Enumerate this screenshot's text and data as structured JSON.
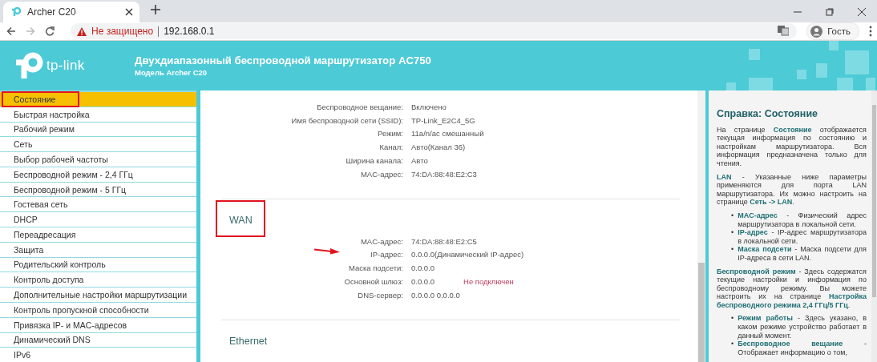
{
  "browser": {
    "tabs": [
      {
        "title": "Archer C20",
        "selected": true
      }
    ],
    "security": "Не защищено",
    "url": "192.168.0.1",
    "forward_disabled": true,
    "profile": "Гость"
  },
  "header": {
    "logo": "tp-link",
    "title": "Двухдиапазонный беспроводной маршрутизатор AC750",
    "model": "Модель Archer C20"
  },
  "menu": [
    {
      "label": "Состояние",
      "selected": true,
      "highlighted": true
    },
    {
      "label": "Быстрая настройка",
      "selected": false,
      "highlighted": false
    },
    {
      "label": "Рабочий режим",
      "selected": false,
      "highlighted": false
    },
    {
      "label": "Сеть",
      "selected": false,
      "highlighted": false
    },
    {
      "label": "Выбор рабочей частоты",
      "selected": false,
      "highlighted": false
    },
    {
      "label": "Беспроводной режим - 2,4 ГГц",
      "selected": false,
      "highlighted": false
    },
    {
      "label": "Беспроводной режим - 5 ГГц",
      "selected": false,
      "highlighted": false
    },
    {
      "label": "Гостевая сеть",
      "selected": false,
      "highlighted": false
    },
    {
      "label": "DHCP",
      "selected": false,
      "highlighted": false
    },
    {
      "label": "Переадресация",
      "selected": false,
      "highlighted": false
    },
    {
      "label": "Защита",
      "selected": false,
      "highlighted": false
    },
    {
      "label": "Родительский контроль",
      "selected": false,
      "highlighted": false
    },
    {
      "label": "Контроль доступа",
      "selected": false,
      "highlighted": false
    },
    {
      "label": "Дополнительные настройки маршрутизации",
      "selected": false,
      "highlighted": false
    },
    {
      "label": "Контроль пропускной способности",
      "selected": false,
      "highlighted": false
    },
    {
      "label": "Привязка IP- и MAC-адресов",
      "selected": false,
      "highlighted": false
    },
    {
      "label": "Динамический DNS",
      "selected": false,
      "highlighted": false
    },
    {
      "label": "IPv6",
      "selected": false,
      "highlighted": false
    }
  ],
  "sections": [
    {
      "rows": [
        {
          "label": "Беспроводное вещание:",
          "value": "Включено",
          "arrow": false
        },
        {
          "label": "Имя беспроводной сети (SSID):",
          "value": "TP-Link_E2C4_5G",
          "arrow": false
        },
        {
          "label": "Режим:",
          "value": "11a/n/ac смешанный",
          "arrow": false
        },
        {
          "label": "Канал:",
          "value": "Авто(Канал 36)",
          "arrow": false
        },
        {
          "label": "Ширина канала:",
          "value": "Авто",
          "arrow": false
        },
        {
          "label": "MAC-адрес:",
          "value": "74:DA:88:48:E2:C3",
          "arrow": false
        }
      ]
    },
    {
      "title": "WAN",
      "highlighted": true,
      "rows": [
        {
          "label": "MAC-адрес:",
          "value": "74:DA:88:48:E2:C5",
          "arrow": false
        },
        {
          "label": "IP-адрес:",
          "value": "0.0.0.0(Динамический IP-адрес)",
          "arrow": true
        },
        {
          "label": "Маска подсети:",
          "value": "0.0.0.0",
          "arrow": false
        },
        {
          "label": "Основной шлюз:",
          "value": "0.0.0.0",
          "status": "Не подключен",
          "arrow": false
        },
        {
          "label": "DNS-сервер:",
          "value": "0.0.0.0 0.0.0.0",
          "arrow": false
        }
      ]
    },
    {
      "title": "Ethernet",
      "highlighted": false
    }
  ],
  "help": {
    "title": "Справка: Состояние",
    "blocks": [
      {
        "kind": "paragraph",
        "text": "На странице **Состояние** отображается текущая информация по состоянию и настройкам маршрутизатора. Вся информация предназначена только для чтения."
      },
      {
        "kind": "paragraph",
        "text": "**LAN** - Указанные ниже параметры применяются для порта LAN маршрутизатора. Их можно настроить на странице **Сеть -> LAN**."
      },
      {
        "kind": "list",
        "bullet": "•",
        "items": [
          "**MAC-адрес** - Физический адрес маршрутизатора в локальной сети.",
          "**IP-адрес** - IP-адрес маршрутизатора в локальной сети.",
          "**Маска подсети** - Маска подсети для IP-адреса в сети LAN."
        ]
      },
      {
        "kind": "paragraph",
        "text": "**Беспроводной режим** - Здесь содержатся текущие настройки и информация по беспроводному режиму. Вы можете настроить их на странице **Настройка беспроводного режима 2,4 ГГц/5 ГГц**."
      },
      {
        "kind": "list",
        "bullet": "•",
        "items": [
          "**Режим работы** - Здесь указано, в каком режиме устройство работает в данный момент.",
          "**Беспроводное вещание** - Отображает информацию о том,"
        ]
      }
    ]
  }
}
